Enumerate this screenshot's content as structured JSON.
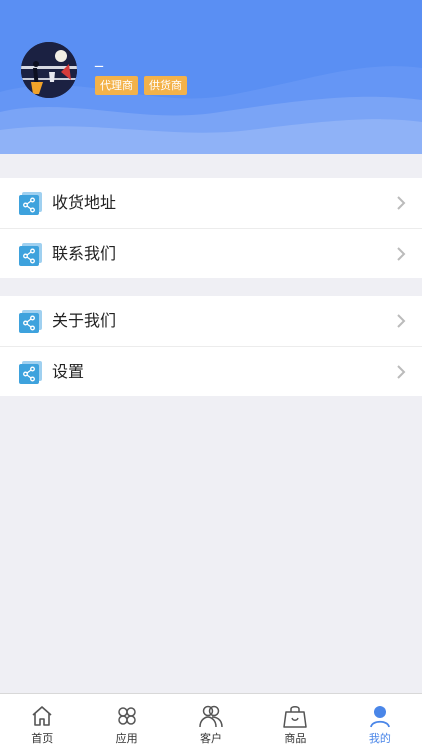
{
  "profile": {
    "username": "_",
    "tags": [
      "代理商",
      "供货商"
    ]
  },
  "menu": {
    "group1": [
      {
        "label": "收货地址",
        "icon": "share-icon"
      },
      {
        "label": "联系我们",
        "icon": "share-icon"
      }
    ],
    "group2": [
      {
        "label": "关于我们",
        "icon": "share-icon"
      },
      {
        "label": "设置",
        "icon": "share-icon"
      }
    ]
  },
  "tabbar": {
    "items": [
      {
        "label": "首页",
        "icon": "home-icon"
      },
      {
        "label": "应用",
        "icon": "apps-icon"
      },
      {
        "label": "客户",
        "icon": "customers-icon"
      },
      {
        "label": "商品",
        "icon": "shopping-bag-icon"
      },
      {
        "label": "我的",
        "icon": "user-icon"
      }
    ],
    "active": "我的"
  },
  "colors": {
    "header": "#5a8ff3",
    "tag": "#f3b24a",
    "accent": "#4a86e8",
    "background": "#efeff4"
  }
}
